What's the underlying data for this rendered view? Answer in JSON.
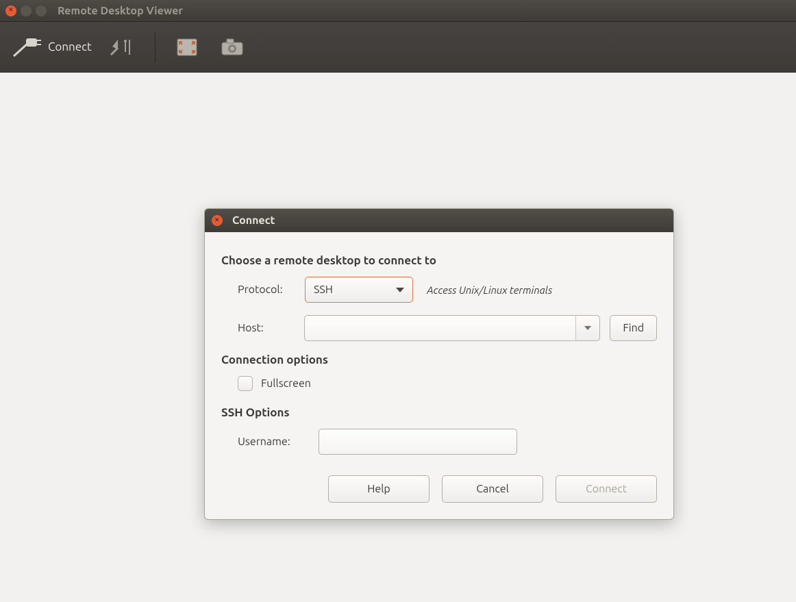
{
  "window": {
    "title": "Remote Desktop Viewer"
  },
  "toolbar": {
    "connect_label": "Connect"
  },
  "dialog": {
    "title": "Connect",
    "section_choose": "Choose a remote desktop to connect to",
    "protocol_label": "Protocol:",
    "protocol_value": "SSH",
    "protocol_hint": "Access Unix/Linux terminals",
    "host_label": "Host:",
    "host_value": "",
    "find_label": "Find",
    "section_conn_opts": "Connection options",
    "fullscreen_label": "Fullscreen",
    "fullscreen_checked": false,
    "section_ssh_opts": "SSH Options",
    "username_label": "Username:",
    "username_value": "",
    "help_label": "Help",
    "cancel_label": "Cancel",
    "connect_label": "Connect"
  }
}
